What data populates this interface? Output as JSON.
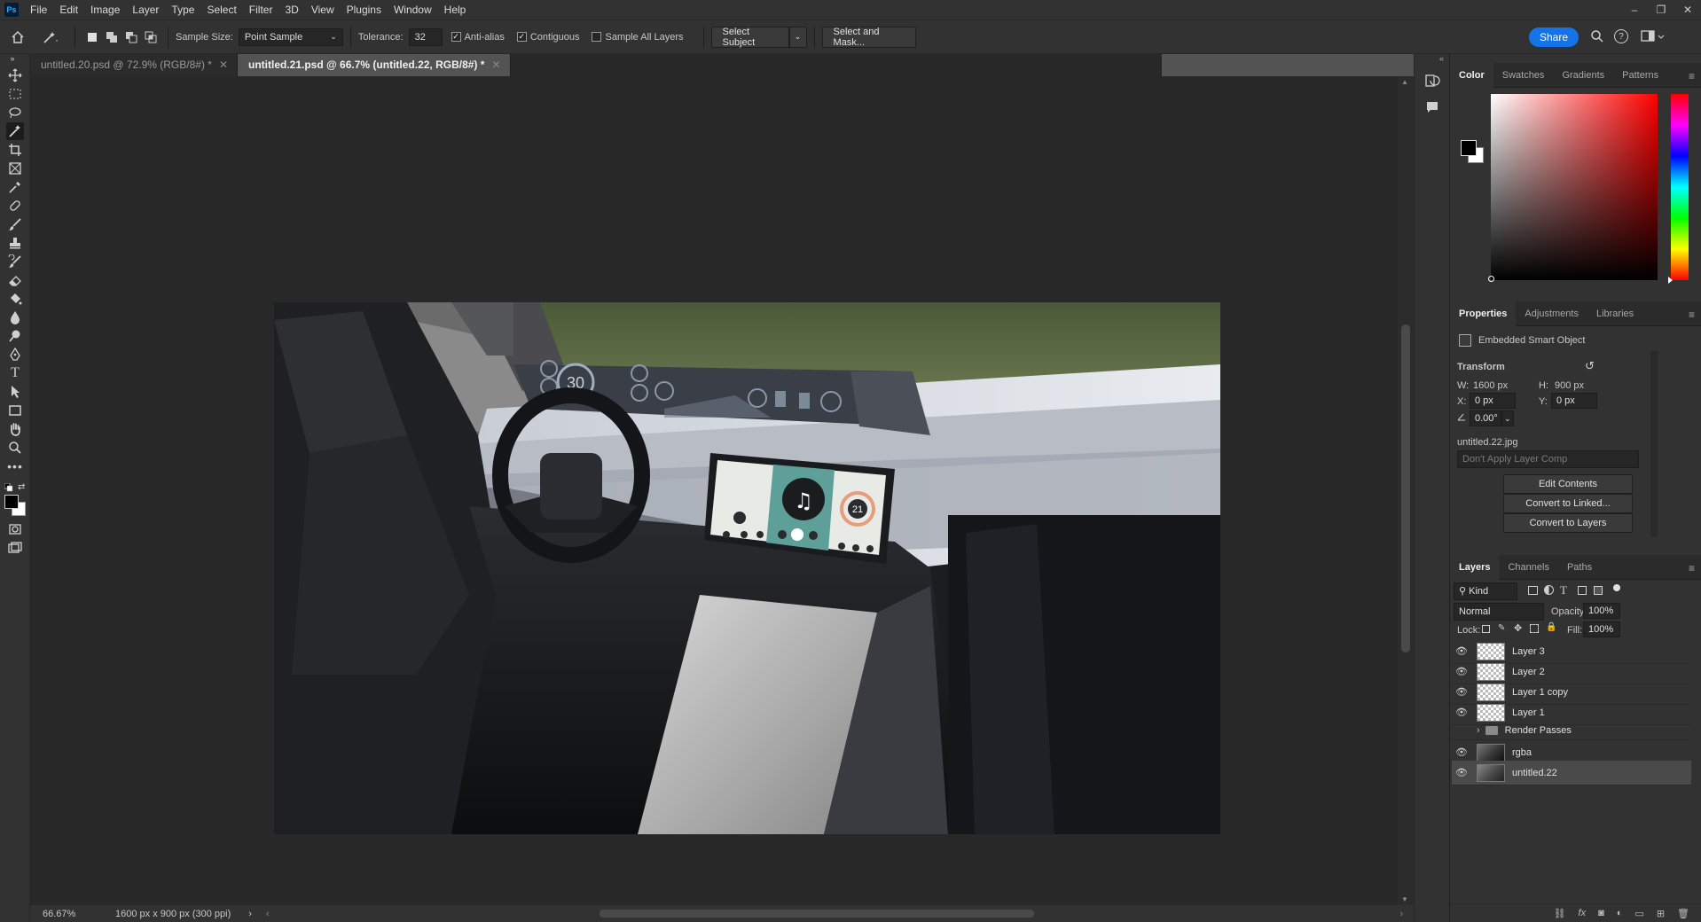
{
  "app": {
    "logo": "Ps"
  },
  "menu": [
    "File",
    "Edit",
    "Image",
    "Layer",
    "Type",
    "Select",
    "Filter",
    "3D",
    "View",
    "Plugins",
    "Window",
    "Help"
  ],
  "window_controls": [
    "–",
    "❐",
    "✕"
  ],
  "options": {
    "sample_size_label": "Sample Size:",
    "sample_size_value": "Point Sample",
    "tolerance_label": "Tolerance:",
    "tolerance_value": "32",
    "anti_alias": "Anti-alias",
    "contiguous": "Contiguous",
    "sample_all_layers": "Sample All Layers",
    "select_subject": "Select Subject",
    "select_and_mask": "Select and Mask...",
    "share": "Share"
  },
  "tabs": [
    {
      "label": "untitled.20.psd @ 72.9% (RGB/8#) *",
      "active": false
    },
    {
      "label": "untitled.21.psd @ 66.7% (untitled.22, RGB/8#) *",
      "active": true
    }
  ],
  "status": {
    "zoom": "66.67%",
    "doc_info": "1600 px x 900 px (300 ppi)"
  },
  "color_panel": {
    "tabs": [
      "Color",
      "Swatches",
      "Gradients",
      "Patterns"
    ],
    "hue_color": "#ff0000"
  },
  "properties": {
    "tabs": [
      "Properties",
      "Adjustments",
      "Libraries"
    ],
    "type": "Embedded Smart Object",
    "transform_label": "Transform",
    "w_label": "W:",
    "w_value": "1600 px",
    "h_label": "H:",
    "h_value": "900 px",
    "x_label": "X:",
    "x_value": "0 px",
    "y_label": "Y:",
    "y_value": "0 px",
    "angle_value": "0.00°",
    "filename": "untitled.22.jpg",
    "layer_comp": "Don't Apply Layer Comp",
    "edit_contents": "Edit Contents",
    "convert_linked": "Convert to Linked...",
    "convert_layers": "Convert to Layers"
  },
  "layers_panel": {
    "tabs": [
      "Layers",
      "Channels",
      "Paths"
    ],
    "kind": "Kind",
    "blend_mode": "Normal",
    "opacity_label": "Opacity:",
    "opacity_value": "100%",
    "lock_label": "Lock:",
    "fill_label": "Fill:",
    "fill_value": "100%",
    "layers": [
      {
        "name": "Layer 3",
        "visible": true,
        "type": "pixel"
      },
      {
        "name": "Layer 2",
        "visible": true,
        "type": "pixel"
      },
      {
        "name": "Layer 1 copy",
        "visible": true,
        "type": "pixel"
      },
      {
        "name": "Layer 1",
        "visible": true,
        "type": "pixel"
      },
      {
        "name": "Render Passes",
        "visible": false,
        "type": "group"
      },
      {
        "name": "rgba",
        "visible": true,
        "type": "image"
      },
      {
        "name": "untitled.22",
        "visible": true,
        "type": "smart",
        "selected": true
      }
    ]
  },
  "screen_display": {
    "speed": "30",
    "gauge": "21"
  }
}
